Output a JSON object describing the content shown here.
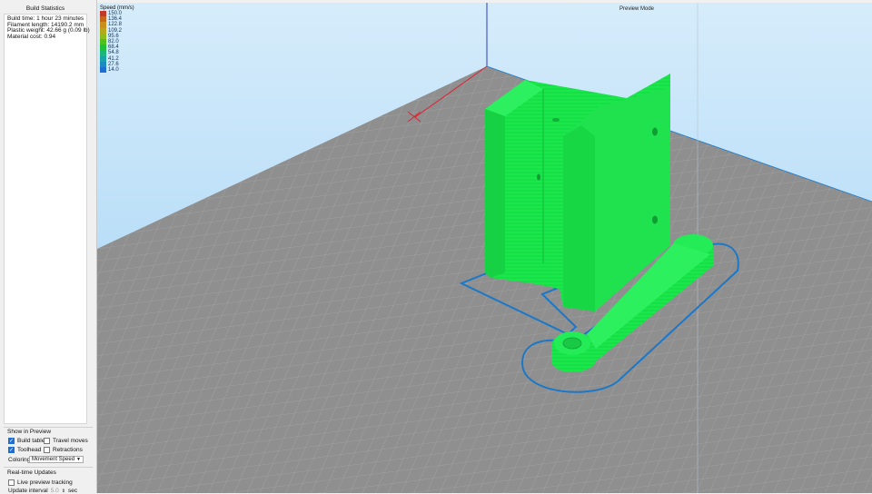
{
  "sidebar": {
    "stats_title": "Build Statistics",
    "stats": [
      "Build time: 1 hour 23 minutes",
      "Filament length: 14190.2 mm",
      "Plastic weight: 42.66 g (0.09 lb)",
      "Material cost: 0.94"
    ],
    "show_in_preview": {
      "heading": "Show in Preview",
      "build_table": {
        "label": "Build table",
        "checked": true
      },
      "travel_moves": {
        "label": "Travel moves",
        "checked": false
      },
      "toolhead": {
        "label": "Toolhead",
        "checked": true
      },
      "retractions": {
        "label": "Retractions",
        "checked": false
      },
      "coloring_label": "Coloring",
      "coloring_value": "Movement Speed"
    },
    "realtime": {
      "heading": "Real-time Updates",
      "live_tracking": {
        "label": "Live preview tracking",
        "checked": false
      },
      "update_interval_label": "Update interval",
      "update_interval_value": "5.0",
      "update_interval_unit": "sec"
    }
  },
  "viewport": {
    "mode_label": "Preview Mode",
    "legend": {
      "title": "Speed (mm/s)",
      "items": [
        {
          "value": "150.0",
          "color": "#c0392b"
        },
        {
          "value": "136.4",
          "color": "#c8661e"
        },
        {
          "value": "122.8",
          "color": "#c98f1c"
        },
        {
          "value": "109.2",
          "color": "#b5a81a"
        },
        {
          "value": "95.6",
          "color": "#8dbb1c"
        },
        {
          "value": "82.0",
          "color": "#4fc11e"
        },
        {
          "value": "68.4",
          "color": "#1fbf3c"
        },
        {
          "value": "54.8",
          "color": "#1ab67a"
        },
        {
          "value": "41.2",
          "color": "#1aa3a4"
        },
        {
          "value": "27.6",
          "color": "#1a8cc2"
        },
        {
          "value": "14.0",
          "color": "#1f6fd0"
        }
      ]
    },
    "colors": {
      "model": "#19e84b",
      "outline": "#1b78c9",
      "bed": "#8f8f8f",
      "sky_top": "#d6ecfb",
      "sky_bottom": "#9ed1f5"
    }
  }
}
